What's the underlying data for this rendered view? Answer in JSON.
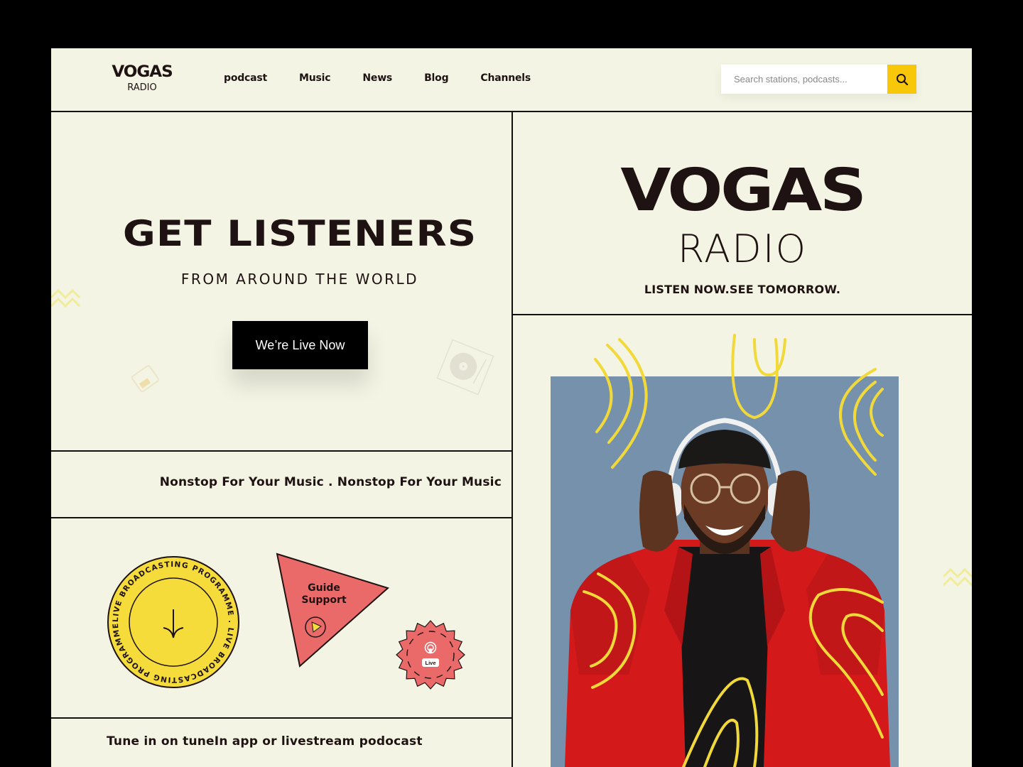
{
  "header": {
    "logo": {
      "main": "VOGAS",
      "sub": "RADIO"
    },
    "nav": [
      {
        "label": "podcast"
      },
      {
        "label": "Music"
      },
      {
        "label": "News"
      },
      {
        "label": "Blog"
      },
      {
        "label": "Channels"
      }
    ],
    "search": {
      "placeholder": "Search stations, podcasts...",
      "value": "",
      "icon": "search-icon"
    }
  },
  "hero": {
    "title": "GET LISTENERS",
    "subtitle": "FROM AROUND THE WORLD",
    "cta_label": "We’re Live Now"
  },
  "brand": {
    "title": "VOGAS",
    "subtitle": "RADIO",
    "tagline": "LISTEN NOW.SEE TOMORROW."
  },
  "marquee": {
    "text": "Nonstop For Your Music . Nonstop For Your Music"
  },
  "badges": {
    "circle": {
      "ring_text": "LIVE BROADCASTING PROGRAMME . LIVE BROADCASTING PROGRAMME . ",
      "icon": "arrow-down-icon"
    },
    "triangle": {
      "line1": "Guide",
      "line2": "Support",
      "icon": "play-icon"
    },
    "seal": {
      "label": "Live",
      "icon": "podcast-icon"
    }
  },
  "footer_line": {
    "text": "Tune in on tuneIn app or livestream podocast"
  },
  "photo": {
    "description": "man-with-headphones"
  },
  "colors": {
    "background": "#f4f4e4",
    "ink": "#1e1212",
    "accent_yellow": "#f8c70a",
    "badge_yellow": "#f5dc3a",
    "coral": "#ea6a6a",
    "photo_bg": "#7691ac",
    "shirt_red": "#d4191b"
  }
}
